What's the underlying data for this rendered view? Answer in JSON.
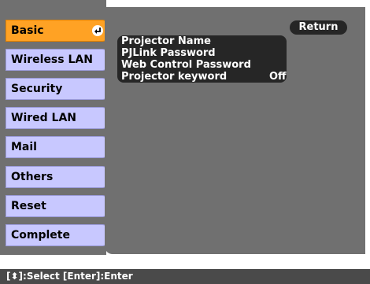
{
  "sidebar": {
    "items": [
      {
        "label": "Basic"
      },
      {
        "label": "Wireless LAN"
      },
      {
        "label": "Security"
      },
      {
        "label": "Wired LAN"
      },
      {
        "label": "Mail"
      },
      {
        "label": "Others"
      },
      {
        "label": "Reset"
      },
      {
        "label": "Complete"
      }
    ],
    "selected_icon": "enter-icon"
  },
  "main": {
    "return_label": "Return",
    "settings": [
      {
        "label": "Projector Name",
        "value": ""
      },
      {
        "label": "PJLink Password",
        "value": ""
      },
      {
        "label": "Web Control Password",
        "value": ""
      },
      {
        "label": "Projector keyword",
        "value": "Off"
      }
    ]
  },
  "status_bar": {
    "text": "[⬍]:Select  [Enter]:Enter"
  },
  "colors": {
    "selected": "#ffa224",
    "menu_item": "#c8c8ff",
    "panel": "#707070",
    "row": "#262626"
  }
}
